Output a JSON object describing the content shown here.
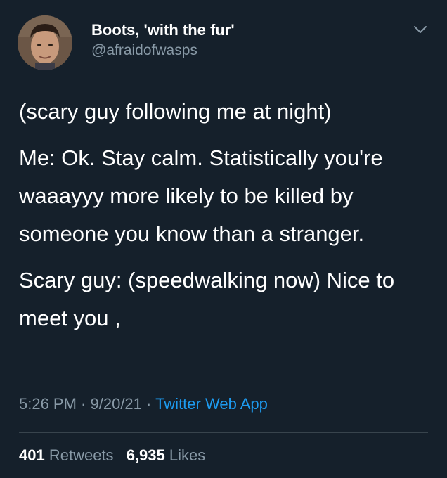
{
  "user": {
    "display_name": "Boots, 'with the fur'",
    "handle": "@afraidofwasps",
    "avatar_icon": "profile-photo"
  },
  "tweet": {
    "paragraphs": [
      "(scary guy following me at night)",
      "Me: Ok. Stay calm. Statistically you're waaayyy more likely to be killed by someone you know than a stranger.",
      "Scary guy: (speedwalking now) Nice to meet you ,"
    ]
  },
  "meta": {
    "time": "5:26 PM",
    "separator": " · ",
    "date": "9/20/21",
    "source": "Twitter Web App"
  },
  "stats": {
    "retweets_count": "401",
    "retweets_label": "Retweets",
    "likes_count": "6,935",
    "likes_label": "Likes"
  },
  "colors": {
    "background": "#15202b",
    "secondary_text": "#8899a6",
    "link": "#1d9bf0",
    "divider": "#38444d"
  },
  "icons": {
    "more": "chevron-down-icon"
  }
}
